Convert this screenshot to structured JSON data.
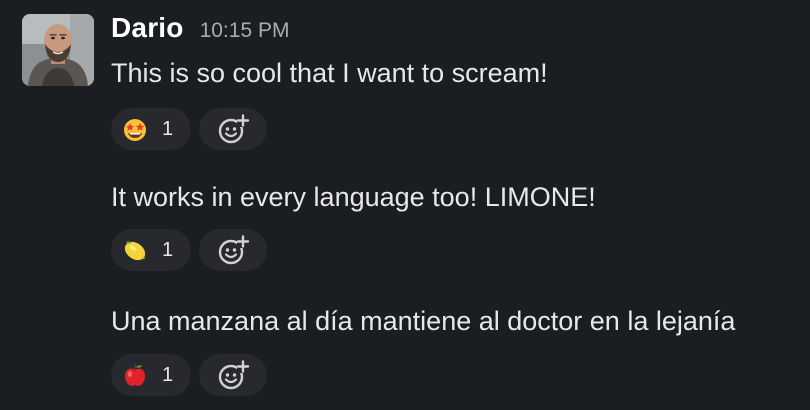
{
  "message": {
    "sender": "Dario",
    "time": "10:15 PM"
  },
  "messages": [
    {
      "text": "This is so cool that I want to scream!",
      "reaction": {
        "emoji": "star-struck-emoji",
        "count": "1"
      }
    },
    {
      "text": "It works in every language too! LIMONE!",
      "reaction": {
        "emoji": "lemon-emoji",
        "count": "1"
      }
    },
    {
      "text": "Una manzana al día mantiene al doctor en la lejanía",
      "reaction": {
        "emoji": "red-apple-emoji",
        "count": "1"
      }
    }
  ],
  "icons": {
    "add_reaction": "add-reaction-icon"
  },
  "colors": {
    "background": "#1a1d21",
    "pill_background": "#27292e",
    "text": "#e8e8e8",
    "timestamp": "#ababad"
  }
}
